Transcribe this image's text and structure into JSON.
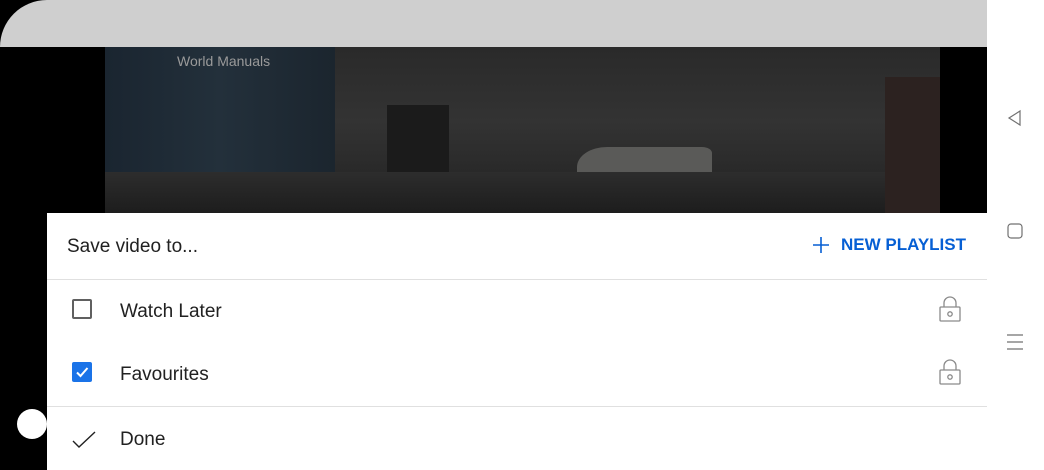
{
  "video": {
    "channel_name": "World Manuals"
  },
  "sheet": {
    "title": "Save video to...",
    "new_playlist_label": "NEW PLAYLIST",
    "playlists": [
      {
        "label": "Watch Later",
        "checked": false,
        "icon": "lock-icon"
      },
      {
        "label": "Favourites",
        "checked": true,
        "icon": "lock-icon"
      }
    ],
    "done_label": "Done"
  },
  "nav": {
    "back_icon": "back-triangle-icon",
    "home_icon": "home-square-icon",
    "recents_icon": "menu-lines-icon"
  },
  "colors": {
    "accent": "#065fd4",
    "checkbox_checked": "#1a73e8",
    "top_bar": "#cfcfcf"
  }
}
